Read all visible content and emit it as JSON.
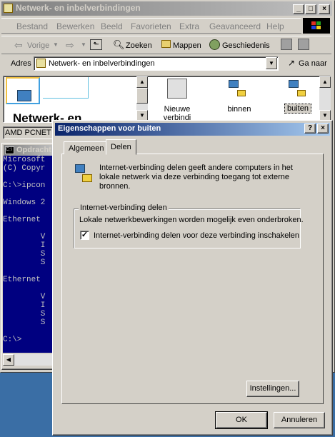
{
  "explorer": {
    "title": "Netwerk- en inbelverbindingen",
    "menu": [
      "Bestand",
      "Bewerken",
      "Beeld",
      "Favorieten",
      "Extra",
      "Geavanceerd",
      "Help"
    ],
    "toolbar": {
      "back": "Vorige",
      "search": "Zoeken",
      "folders": "Mappen",
      "history": "Geschiedenis"
    },
    "address": {
      "label": "Adres",
      "value": "Netwerk- en inbelverbindingen",
      "go": "Ga naar"
    },
    "banner_title": "Netwerk- en",
    "items": [
      "Nieuwe verbindi",
      "binnen",
      "buiten"
    ],
    "status_text": "AMD PCNET F"
  },
  "console": {
    "title": "Opdracht",
    "lines": [
      "Microsoft",
      "(C) Copyr",
      "",
      "C:\\>ipcon",
      "",
      "Windows 2",
      "",
      "Ethernet",
      "",
      "        V",
      "        I",
      "        S",
      "        S",
      "",
      "Ethernet",
      "",
      "        V",
      "        I",
      "        S",
      "        S",
      "",
      "C:\\>"
    ]
  },
  "dialog": {
    "title": "Eigenschappen voor buiten",
    "tabs": [
      "Algemeen",
      "Delen"
    ],
    "description": "Internet-verbinding delen geeft andere computers in het lokale netwerk via deze verbinding toegang tot externe bronnen.",
    "group_title": "Internet-verbinding delen",
    "group_note": "Lokale netwerkbewerkingen worden mogelijk even onderbroken.",
    "checkbox_label": "Internet-verbinding delen voor deze verbinding inschakelen",
    "checkbox_checked": true,
    "settings_button": "Instellingen...",
    "ok_button": "OK",
    "cancel_button": "Annuleren"
  }
}
